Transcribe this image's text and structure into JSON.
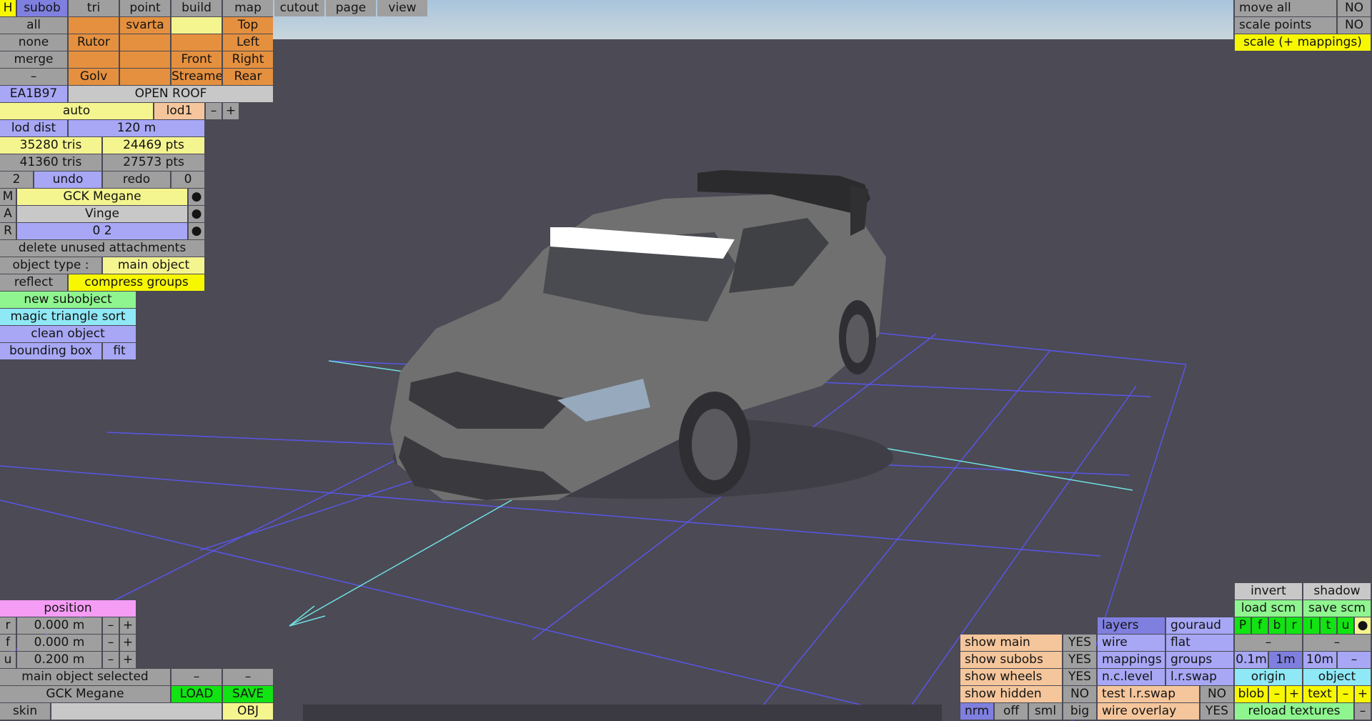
{
  "window": {
    "title": "GCK Megane"
  },
  "menu": [
    "H",
    "subob",
    "tri",
    "point",
    "build",
    "map",
    "cutout",
    "page",
    "view"
  ],
  "groups": {
    "all": "all",
    "svarta": "svarta",
    "top": "Top",
    "none": "none",
    "rutor": "Rutor",
    "left": "Left",
    "merge": "merge",
    "front": "Front",
    "right": "Right",
    "minus": "–",
    "golv": "Golv",
    "streame": "Streame",
    "rear": "Rear"
  },
  "object": {
    "id": "EA1B97",
    "open_roof": "OPEN ROOF",
    "auto": "auto",
    "lod": "lod1",
    "lod_minus": "–",
    "lod_plus": "+",
    "lod_dist_label": "lod dist",
    "lod_dist_value": "120 m",
    "tris1": "35280 tris",
    "pts1": "24469 pts",
    "tris2": "41360 tris",
    "pts2": "27573 pts",
    "undo_count": "2",
    "undo": "undo",
    "redo": "redo",
    "redo_count": "0",
    "m_label": "M",
    "m_value": "GCK Megane",
    "a_label": "A",
    "a_value": "Vinge",
    "r_label": "R",
    "r_value": "0 2",
    "dot": "●",
    "delete_unused": "delete unused attachments",
    "object_type_label": "object type :",
    "object_type_value": "main object",
    "reflect": "reflect",
    "compress_groups": "compress groups",
    "new_subobject": "new subobject",
    "magic_sort": "magic triangle sort",
    "clean_object": "clean object",
    "bounding_box": "bounding box",
    "fit": "fit"
  },
  "position": {
    "title": "position",
    "rows": [
      {
        "axis": "r",
        "value": "0.000 m"
      },
      {
        "axis": "f",
        "value": "0.000 m"
      },
      {
        "axis": "u",
        "value": "0.200 m"
      }
    ],
    "minus": "–",
    "plus": "+"
  },
  "status": {
    "main_selected": "main object selected",
    "dash": "–",
    "name": "GCK Megane",
    "load": "LOAD",
    "save": "SAVE",
    "skin": "skin",
    "obj": "OBJ"
  },
  "topright": {
    "move_all": "move all",
    "move_all_value": "NO",
    "scale_points": "scale points",
    "scale_points_value": "NO",
    "scale_mappings": "scale (+ mappings)"
  },
  "display": {
    "invert": "invert",
    "shadow": "shadow",
    "load_scm": "load scm",
    "save_scm": "save scm",
    "show_main": "show main",
    "show_main_value": "YES",
    "show_subobs": "show subobs",
    "show_subobs_value": "YES",
    "show_wheels": "show wheels",
    "show_wheels_value": "YES",
    "show_hidden": "show hidden",
    "show_hidden_value": "NO",
    "nrm": "nrm",
    "off": "off",
    "sml": "sml",
    "big": "big",
    "layers": "layers",
    "gouraud": "gouraud",
    "wire": "wire",
    "flat": "flat",
    "mappings": "mappings",
    "groups": "groups",
    "nc_level": "n.c.level",
    "lr_swap": "l.r.swap",
    "test_lr_swap": "test l.r.swap",
    "test_lr_swap_value": "NO",
    "wire_overlay": "wire overlay",
    "wire_overlay_value": "YES",
    "views": [
      "P",
      "f",
      "b",
      "r",
      "l",
      "t",
      "u"
    ],
    "dot": "●",
    "dash": "–",
    "grid_01": "0.1m",
    "grid_1": "1m",
    "grid_10": "10m",
    "origin": "origin",
    "object_btn": "object",
    "blob": "blob",
    "minus": "–",
    "plus": "+",
    "text": "text",
    "reload_textures": "reload textures"
  },
  "colors": {
    "background": "#4b4a55",
    "grid": "#5a55e6",
    "axis": "#6fe0e0",
    "car_body": "#707070",
    "windshield_banner": "#ffffff"
  }
}
